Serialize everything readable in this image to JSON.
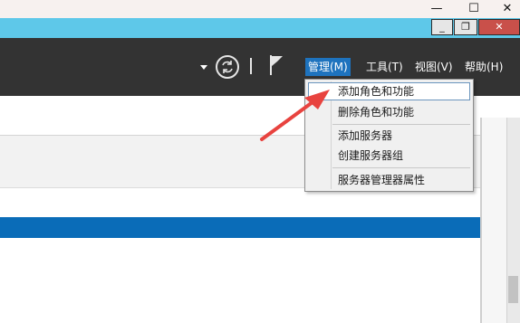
{
  "outer_caption": {
    "minimize_glyph": "—",
    "maximize_glyph": "☐",
    "close_glyph": "✕"
  },
  "inner_caption": {
    "minimize_glyph": "_",
    "restore_glyph": "❐",
    "close_glyph": "✕"
  },
  "toolbar": {
    "icons": [
      "dropdown-arrow-icon",
      "refresh-icon",
      "flag-icon"
    ],
    "menu": [
      "管理(M)",
      "工具(T)",
      "视图(V)",
      "帮助(H)"
    ],
    "active_menu": "管理(M)"
  },
  "dropdown": {
    "items": [
      "添加角色和功能",
      "删除角色和功能",
      "添加服务器",
      "创建服务器组",
      "服务器管理器属性"
    ],
    "highlighted": "添加角色和功能"
  },
  "annotation": {
    "arrow_color": "#e8433f"
  },
  "colors": {
    "title_bar": "#5ec8e9",
    "toolbar": "#333333",
    "menu_active": "#1e73be",
    "content_band": "#0a6cb8",
    "close_button": "#c9504a"
  }
}
